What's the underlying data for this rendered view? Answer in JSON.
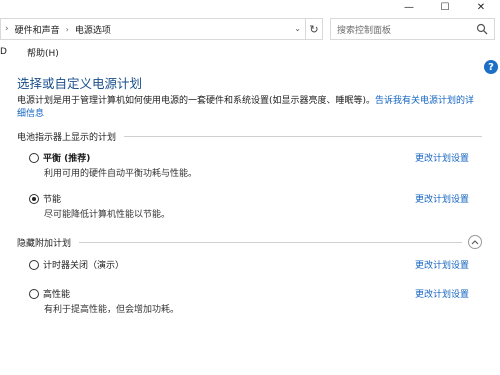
{
  "window": {
    "minimize_glyph": "—",
    "maximize_glyph": "☐",
    "close_glyph": "✕"
  },
  "breadcrumb": {
    "items": [
      "硬件和声音",
      "电源选项"
    ]
  },
  "search": {
    "placeholder": "搜索控制面板"
  },
  "menu": {
    "items": [
      "D",
      "帮助(H)"
    ]
  },
  "page": {
    "title": "选择或自定义电源计划",
    "description": "电源计划是用于管理计算机如何使用电源的一套硬件和系统设置(如显示器亮度、睡眠等)。",
    "description_link": "告诉我有关电源计划的详细信息"
  },
  "battery_section": {
    "title": "电池指示器上显示的计划",
    "plans": [
      {
        "name": "平衡 (推荐)",
        "note": "利用可用的硬件自动平衡功耗与性能。",
        "change_label": "更改计划设置",
        "selected": false
      },
      {
        "name": "节能",
        "note": "尽可能降低计算机性能以节能。",
        "change_label": "更改计划设置",
        "selected": true
      }
    ]
  },
  "hidden_section": {
    "title": "隐藏附加计划",
    "plans": [
      {
        "name": "计时器关闭（演示）",
        "note": "",
        "change_label": "更改计划设置",
        "selected": false
      },
      {
        "name": "高性能",
        "note": "有利于提高性能，但会增加功耗。",
        "change_label": "更改计划设置",
        "selected": false
      }
    ]
  }
}
